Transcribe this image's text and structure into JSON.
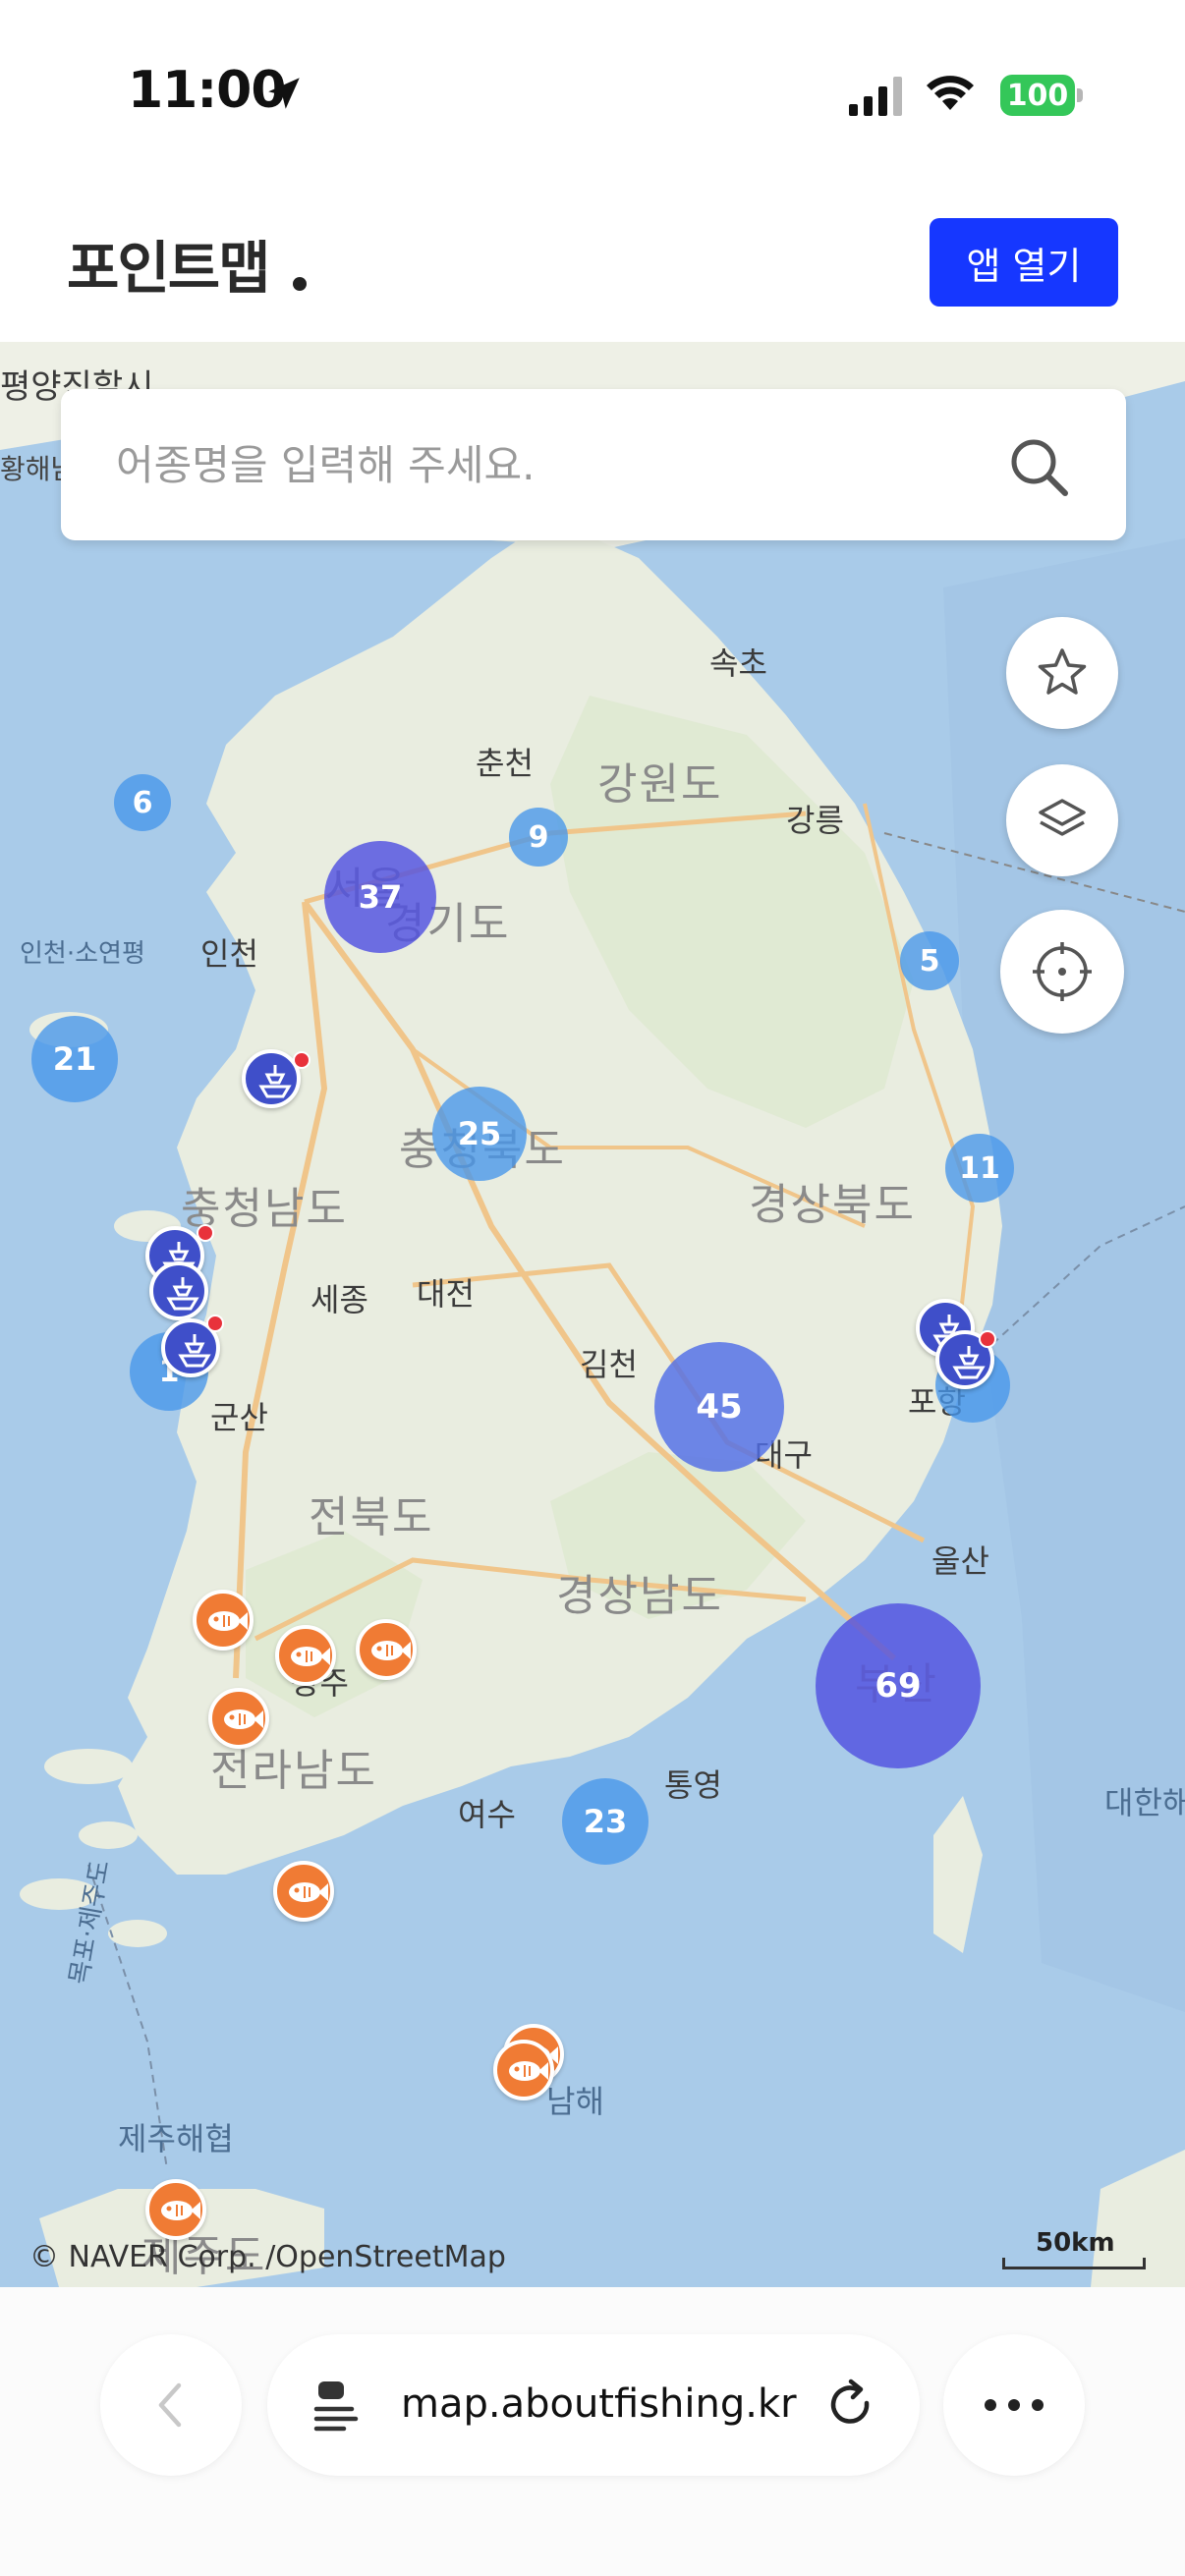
{
  "status": {
    "time": "11:00",
    "battery": "100"
  },
  "header": {
    "brand": "포인트맵",
    "open_app_label": "앱 열기"
  },
  "search": {
    "placeholder": "어종명을 입력해 주세요."
  },
  "map": {
    "places": {
      "pyongyang": "평양직할시",
      "namdo": "황해남도",
      "sokcho": "속초",
      "chuncheon": "춘천",
      "gangwon": "강원도",
      "gangneung": "강릉",
      "seoul": "서울",
      "gyeonggi": "경기도",
      "incheon": "인천",
      "incheon_sea": "인천·소연평",
      "chungbuk": "충청북도",
      "chungnam": "충청남도",
      "gyeongbuk": "경상북도",
      "sejong": "세종",
      "daejeon": "대전",
      "gimcheon": "김천",
      "daegu": "대구",
      "pohang": "포항",
      "gunsan": "군산",
      "jeonbuk": "전북도",
      "ulsan": "울산",
      "gyeongnam": "경상남도",
      "busan": "부산",
      "gwangju": "광주",
      "jeonnam": "전라남도",
      "yeosu": "여수",
      "tongyeong": "통영",
      "korea_strait": "대한해",
      "mokpo_jeju": "목포·제주도",
      "namhae": "남해",
      "jeju_strait": "제주해협",
      "jeju": "제주도"
    },
    "clusters": {
      "c6": "6",
      "c37": "37",
      "c9": "9",
      "c5": "5",
      "c21": "21",
      "c25": "25",
      "c11": "11",
      "c1": "1",
      "c45": "45",
      "c69": "69",
      "c23": "23",
      "c_pohang": ""
    },
    "attribution": "© NAVER Corp. /OpenStreetMap",
    "scale_label": "50km"
  },
  "browser": {
    "url": "map.aboutfishing.kr"
  },
  "colors": {
    "accent": "#1637ff",
    "cluster": "#4a6fe0",
    "fish_marker": "#f07b34",
    "boat_marker": "#3f4fc9",
    "sea": "#a9cbe9",
    "land": "#eef0e6"
  }
}
